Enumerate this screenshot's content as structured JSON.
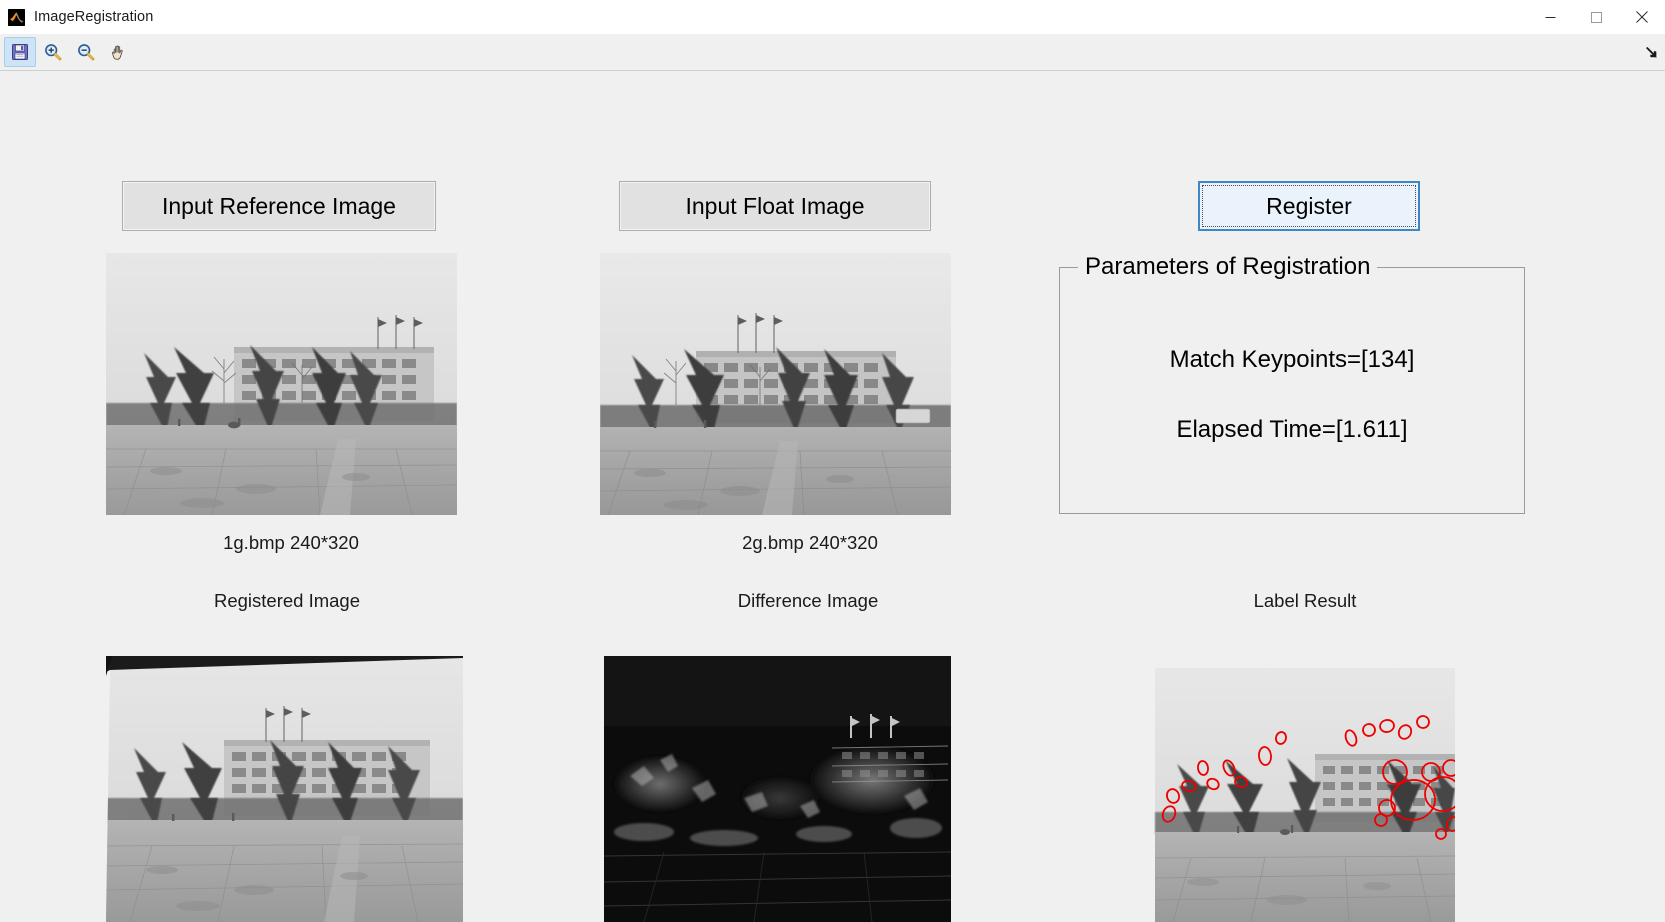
{
  "window": {
    "title": "ImageRegistration",
    "app_icon": "matlab-icon",
    "minimize_label": "Minimize",
    "maximize_label": "Maximize",
    "close_label": "Close"
  },
  "toolbar": {
    "items": [
      {
        "name": "save-figure-button",
        "icon": "save-icon",
        "label": "Save Figure",
        "selected": true
      },
      {
        "name": "zoom-in-button",
        "icon": "zoom-in-icon",
        "label": "Zoom In",
        "selected": false
      },
      {
        "name": "zoom-out-button",
        "icon": "zoom-out-icon",
        "label": "Zoom Out",
        "selected": false
      },
      {
        "name": "pan-button",
        "icon": "pan-hand-icon",
        "label": "Pan",
        "selected": false
      }
    ],
    "overflow_icon": "overflow-arrow-icon"
  },
  "buttons": {
    "input_reference": "Input Reference Image",
    "input_float": "Input Float Image",
    "register": "Register"
  },
  "panel": {
    "title": "Parameters of Registration",
    "match_keypoints": "Match Keypoints=[134]",
    "elapsed_time": "Elapsed Time=[1.611]"
  },
  "captions": {
    "reference_file": "1g.bmp 240*320",
    "float_file": "2g.bmp 240*320",
    "registered": "Registered Image",
    "difference": "Difference Image",
    "label_result": "Label Result"
  },
  "colors": {
    "window_bg": "#f0f0f0",
    "button_face": "#e1e1e1",
    "focus_border": "#3d87c9",
    "focus_fill": "#eaf3fb",
    "keypoint_marker": "#ee0000",
    "panel_border": "#9a9a9a"
  },
  "axes": {
    "reference_image": "grayscale-campus-photo",
    "float_image": "grayscale-campus-photo-shifted",
    "registered_image": "grayscale-campus-photo-warped",
    "difference_image": "grayscale-difference-map",
    "label_result_image": "grayscale-campus-photo-with-keypoints"
  }
}
